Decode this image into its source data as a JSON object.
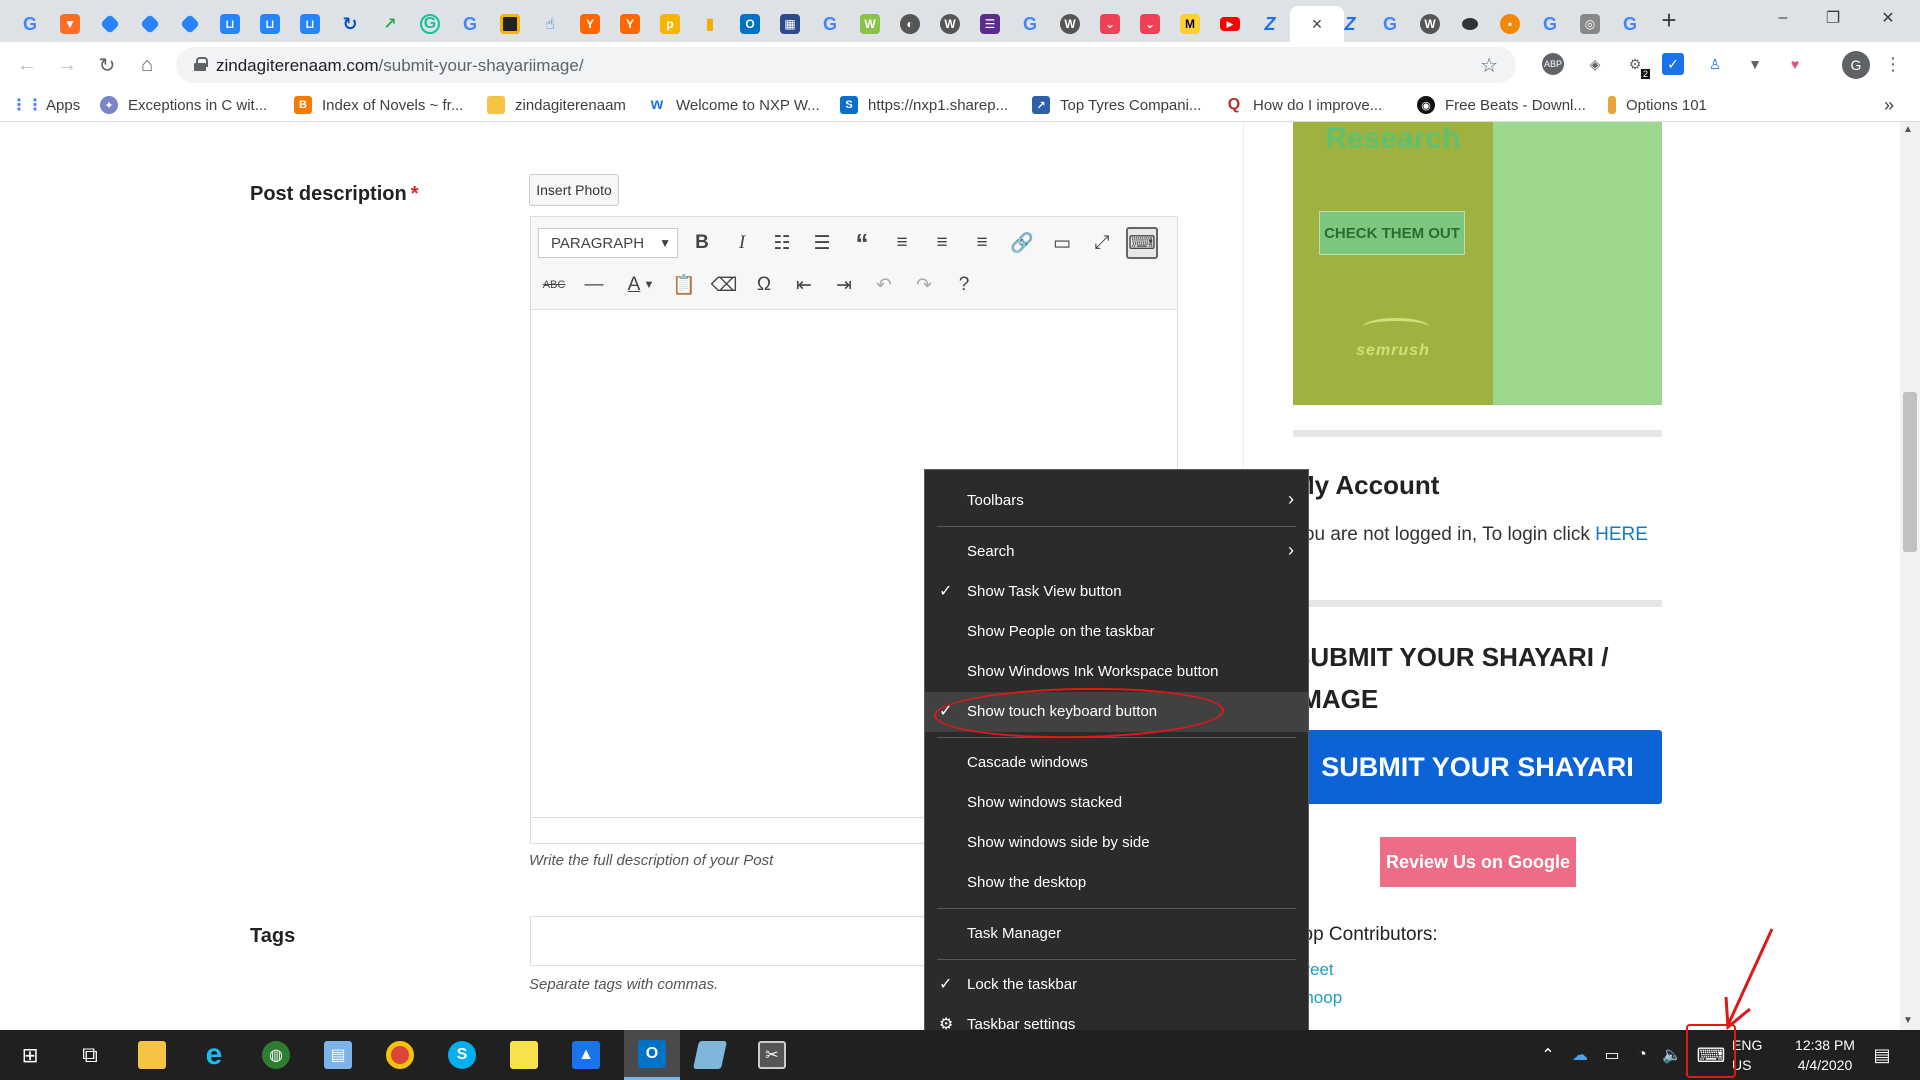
{
  "browser": {
    "tab_icons": [
      "google",
      "gitlab",
      "jira",
      "jira",
      "jira",
      "bitbucket",
      "bitbucket",
      "bitbucket",
      "sourcetree",
      "trend",
      "grammarly",
      "google",
      "slides",
      "touch",
      "ycombinator",
      "ycombinator",
      "producthunt",
      "analytics",
      "outlook",
      "calendar",
      "google",
      "wattpad",
      "world",
      "wordpress",
      "stackedit",
      "google",
      "wordpress",
      "pocket",
      "pocket",
      "miro",
      "youtube",
      "active-tab",
      "bitly",
      "google",
      "wordpress",
      "chat",
      "drawio",
      "google",
      "cast",
      "google"
    ],
    "active_tab_close": "×",
    "new_tab": "+",
    "window_controls": {
      "minimize": "–",
      "maximize": "❐",
      "close": "✕"
    },
    "url_domain": "zindagiterenaam.com",
    "url_path": "/submit-your-shayariimage/",
    "extension_badge": "2",
    "profile_initial": "G",
    "bookmarks": [
      {
        "label": "Apps",
        "color": "#4285f4"
      },
      {
        "label": "Exceptions in C wit...",
        "color": "#7a85c8"
      },
      {
        "label": "Index of Novels ~ fr...",
        "color": "#f57c00"
      },
      {
        "label": "zindagiterenaam",
        "color": "#f6c343"
      },
      {
        "label": "Welcome to NXP W...",
        "color": "#f7b500"
      },
      {
        "label": "https://nxp1.sharep...",
        "color": "#0b6fc7"
      },
      {
        "label": "Top Tyres Compani...",
        "color": "#2f5fa8"
      },
      {
        "label": "How do I improve...",
        "color": "#b92b27"
      },
      {
        "label": "Free Beats - Downl...",
        "color": "#111111"
      },
      {
        "label": "Options 101",
        "color": "#e8a33a"
      }
    ],
    "bookmarks_more": "»"
  },
  "page": {
    "post_description_label": "Post description",
    "required_marker": "*",
    "insert_photo": "Insert Photo",
    "paragraph_select": "PARAGRAPH",
    "description_hint": "Write the full description of your Post",
    "tags_label": "Tags",
    "tags_hint": "Separate tags with commas."
  },
  "sidebar": {
    "ad_title": "Research",
    "ad_cta": "CHECK THEM OUT",
    "ad_logo": "semrush",
    "my_account": "My Account",
    "login_text": "You are not logged in, To login click",
    "login_link": "HERE",
    "submit_title": "SUBMIT YOUR SHAYARI / IMAGE",
    "submit_button": "SUBMIT YOUR SHAYARI",
    "review_button": "Review Us on Google",
    "top_contributors": "Top Contributors:",
    "contributors": [
      "Preet",
      "Anoop"
    ]
  },
  "context_menu": {
    "toolbars": "Toolbars",
    "search": "Search",
    "show_task_view": "Show Task View button",
    "show_people": "Show People on the taskbar",
    "show_ink": "Show Windows Ink Workspace button",
    "show_touch_keyboard": "Show touch keyboard button",
    "cascade": "Cascade windows",
    "stacked": "Show windows stacked",
    "side_by_side": "Show windows side by side",
    "show_desktop": "Show the desktop",
    "task_manager": "Task Manager",
    "lock_taskbar": "Lock the taskbar",
    "taskbar_settings": "Taskbar settings"
  },
  "taskbar": {
    "apps": [
      "start",
      "task-view",
      "file-explorer",
      "internet-explorer",
      "network-globe",
      "paint-app",
      "chrome",
      "skype",
      "sticky-notes",
      "photos",
      "outlook",
      "notepad",
      "snipping-tool"
    ],
    "lang_line1": "ENG",
    "lang_line2": "US",
    "time": "12:38 PM",
    "date": "4/4/2020"
  }
}
